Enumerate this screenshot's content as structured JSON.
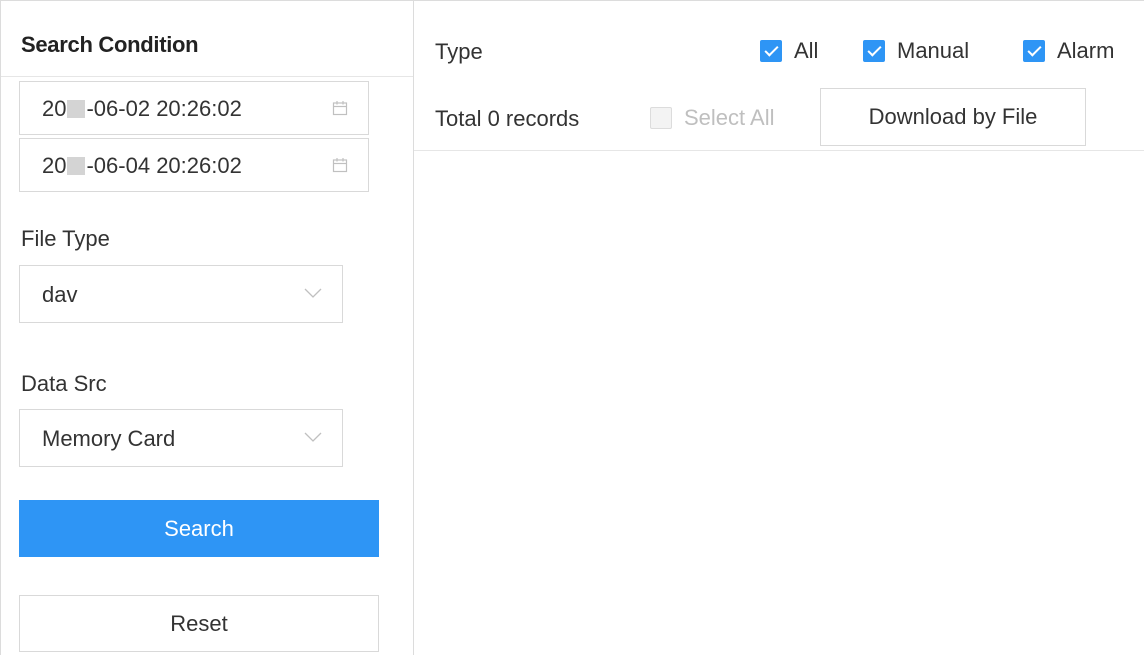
{
  "search_panel": {
    "title": "Search Condition",
    "start_time": {
      "prefix": "20",
      "suffix": "-06-02 20:26:02"
    },
    "end_time": {
      "prefix": "20",
      "suffix": "-06-04 20:26:02"
    },
    "file_type": {
      "label": "File Type",
      "value": "dav"
    },
    "data_src": {
      "label": "Data Src",
      "value": "Memory Card"
    },
    "search_label": "Search",
    "reset_label": "Reset"
  },
  "results": {
    "type_label": "Type",
    "filters": [
      {
        "label": "All",
        "checked": true
      },
      {
        "label": "Manual",
        "checked": true
      },
      {
        "label": "Alarm",
        "checked": true
      }
    ],
    "total_label": "Total 0 records",
    "select_all_label": "Select All",
    "download_label": "Download by File"
  },
  "colors": {
    "accent": "#2e95f5",
    "border": "#d9d9d9"
  },
  "icons": {
    "date_picker": "calendar-icon",
    "select": "chevron-down-icon"
  }
}
